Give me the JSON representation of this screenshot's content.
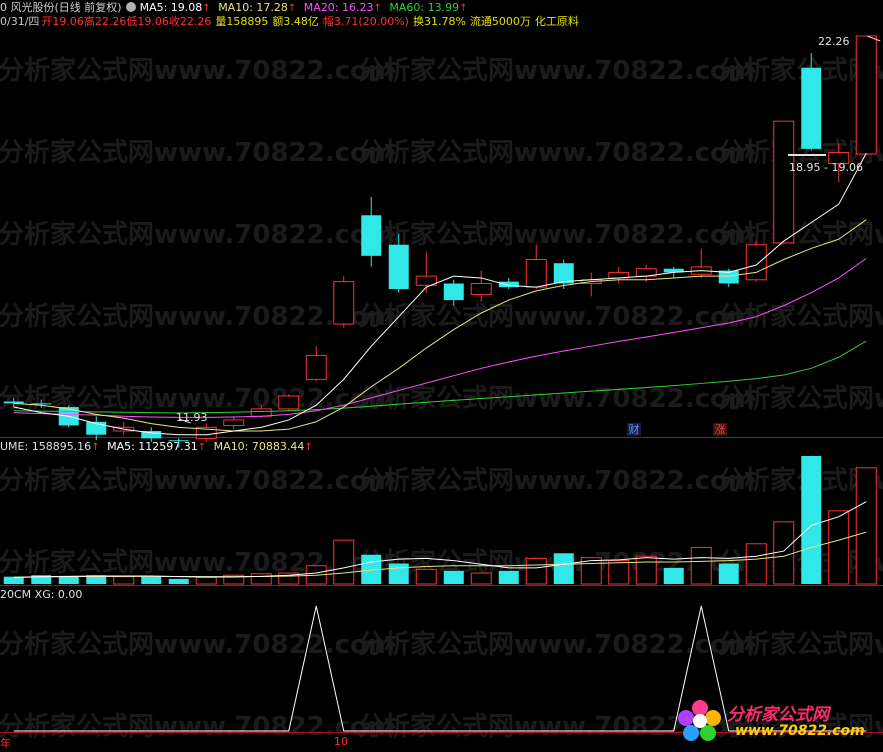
{
  "header": {
    "stock_name": "0 风光股份(日线 前复权)",
    "ma5": "MA5: 19.08",
    "ma10": "MA10: 17.28",
    "ma20": "MA20: 16.23",
    "ma60": "MA60: 13.99",
    "ma_colors": {
      "ma5": "#ffffff",
      "ma10": "#e6e680",
      "ma20": "#ff50ff",
      "ma60": "#30d030"
    }
  },
  "quote": {
    "date": "0/31/四",
    "open_label": "开",
    "open": "19.06",
    "high_label": "高",
    "high": "22.26",
    "low_label": "低",
    "low": "19.06",
    "close_label": "收",
    "close": "22.26",
    "volume_label": "量",
    "volume": "158895",
    "amount_label": "额",
    "amount": "3.48亿",
    "change_label": "幅",
    "change": "3.71(20.00%)",
    "turnover_label": "换",
    "turnover": "31.78%",
    "float_label": "流通",
    "float": "5000万",
    "sector": "化工原料"
  },
  "price_panel": {
    "high_marker": "22.26",
    "low_marker": "11.93",
    "range_marker": "18.95 - 19.06",
    "tags": [
      {
        "text": "财",
        "color": "#4aa0ff"
      },
      {
        "text": "涨",
        "color": "#ff4040"
      }
    ]
  },
  "volume_panel": {
    "volume": "UME: 158895.16",
    "ma5": "MA5: 112597.31",
    "ma10": "MA10: 70883.44"
  },
  "indicator_panel": {
    "label": "20CM XG: 0.00"
  },
  "x_axis": {
    "left_label": "年",
    "mid_label": "10"
  },
  "watermark": "分析家公式网www.70822.com",
  "logo": {
    "title": "分析家公式网",
    "url": "www.70822.com"
  },
  "colors": {
    "up": "#ff3030",
    "down": "#30e8e8",
    "panel_border": "#b01010"
  },
  "chart_data": {
    "type": "candlestick",
    "candles": [
      {
        "o": 12.35,
        "c": 12.3,
        "h": 12.45,
        "l": 12.2
      },
      {
        "o": 12.3,
        "c": 12.28,
        "h": 12.4,
        "l": 12.18
      },
      {
        "o": 12.2,
        "c": 11.7,
        "h": 12.25,
        "l": 11.65
      },
      {
        "o": 11.8,
        "c": 11.45,
        "h": 11.95,
        "l": 11.3
      },
      {
        "o": 11.55,
        "c": 11.65,
        "h": 11.8,
        "l": 11.45
      },
      {
        "o": 11.55,
        "c": 11.35,
        "h": 11.65,
        "l": 11.25
      },
      {
        "o": 11.3,
        "c": 11.28,
        "h": 11.35,
        "l": 11.1
      },
      {
        "o": 11.35,
        "c": 11.65,
        "h": 11.75,
        "l": 11.25
      },
      {
        "o": 11.7,
        "c": 11.85,
        "h": 11.95,
        "l": 11.6
      },
      {
        "o": 11.95,
        "c": 12.15,
        "h": 12.25,
        "l": 11.9
      },
      {
        "o": 12.15,
        "c": 12.5,
        "h": 12.55,
        "l": 12.1
      },
      {
        "o": 12.95,
        "c": 13.6,
        "h": 13.85,
        "l": 12.9
      },
      {
        "o": 14.45,
        "c": 15.6,
        "h": 15.75,
        "l": 14.35
      },
      {
        "o": 17.4,
        "c": 16.3,
        "h": 17.9,
        "l": 16.0
      },
      {
        "o": 16.6,
        "c": 15.4,
        "h": 16.9,
        "l": 15.3
      },
      {
        "o": 15.5,
        "c": 15.75,
        "h": 16.4,
        "l": 15.3
      },
      {
        "o": 15.55,
        "c": 15.1,
        "h": 15.65,
        "l": 14.95
      },
      {
        "o": 15.25,
        "c": 15.55,
        "h": 15.9,
        "l": 15.05
      },
      {
        "o": 15.6,
        "c": 15.45,
        "h": 15.7,
        "l": 15.4
      },
      {
        "o": 15.45,
        "c": 16.2,
        "h": 16.6,
        "l": 15.4
      },
      {
        "o": 16.1,
        "c": 15.55,
        "h": 16.2,
        "l": 15.4
      },
      {
        "o": 15.55,
        "c": 15.65,
        "h": 15.85,
        "l": 15.2
      },
      {
        "o": 15.7,
        "c": 15.85,
        "h": 16.0,
        "l": 15.55
      },
      {
        "o": 15.75,
        "c": 15.95,
        "h": 16.05,
        "l": 15.6
      },
      {
        "o": 15.95,
        "c": 15.85,
        "h": 16.0,
        "l": 15.7
      },
      {
        "o": 15.8,
        "c": 16.0,
        "h": 16.5,
        "l": 15.7
      },
      {
        "o": 15.9,
        "c": 15.55,
        "h": 15.95,
        "l": 15.45
      },
      {
        "o": 15.65,
        "c": 16.6,
        "h": 16.7,
        "l": 15.6
      },
      {
        "o": 16.65,
        "c": 19.95,
        "h": 19.95,
        "l": 16.65
      },
      {
        "o": 21.4,
        "c": 19.2,
        "h": 21.8,
        "l": 19.15
      },
      {
        "o": 18.8,
        "c": 19.1,
        "h": 19.35,
        "l": 18.3
      },
      {
        "o": 19.06,
        "c": 22.26,
        "h": 22.26,
        "l": 19.06
      }
    ],
    "ma5": [
      12.2,
      12.05,
      11.95,
      11.75,
      11.6,
      11.5,
      11.45,
      11.45,
      11.55,
      11.65,
      11.85,
      12.25,
      12.95,
      13.85,
      14.65,
      15.45,
      15.75,
      15.7,
      15.5,
      15.45,
      15.6,
      15.65,
      15.7,
      15.75,
      15.85,
      15.9,
      15.85,
      16.05,
      16.7,
      17.2,
      17.7,
      19.08
    ],
    "ma10": [
      12.3,
      12.25,
      12.15,
      12.0,
      11.9,
      11.75,
      11.65,
      11.6,
      11.55,
      11.55,
      11.6,
      11.8,
      12.2,
      12.75,
      13.25,
      13.8,
      14.3,
      14.75,
      15.1,
      15.35,
      15.5,
      15.6,
      15.65,
      15.65,
      15.7,
      15.75,
      15.75,
      15.85,
      16.2,
      16.5,
      16.75,
      17.28
    ],
    "ma20": [
      12.05,
      12.02,
      12.0,
      11.98,
      11.95,
      11.93,
      11.92,
      11.92,
      11.93,
      11.95,
      12.0,
      12.1,
      12.25,
      12.45,
      12.65,
      12.85,
      13.05,
      13.25,
      13.42,
      13.58,
      13.72,
      13.85,
      13.98,
      14.1,
      14.22,
      14.35,
      14.48,
      14.65,
      14.95,
      15.3,
      15.7,
      16.23
    ],
    "ma60": [
      12.1,
      12.09,
      12.08,
      12.07,
      12.06,
      12.05,
      12.04,
      12.05,
      12.06,
      12.08,
      12.1,
      12.13,
      12.17,
      12.22,
      12.28,
      12.33,
      12.38,
      12.43,
      12.48,
      12.53,
      12.58,
      12.63,
      12.68,
      12.73,
      12.78,
      12.84,
      12.9,
      12.97,
      13.07,
      13.25,
      13.55,
      13.99
    ],
    "price_range": [
      11.0,
      23.0
    ],
    "volume": [
      10000,
      12000,
      11000,
      12000,
      10000,
      10000,
      7000,
      9000,
      12000,
      14000,
      15000,
      25000,
      60000,
      40000,
      28000,
      20000,
      18000,
      15000,
      18000,
      35000,
      42000,
      36000,
      32000,
      38000,
      22000,
      50000,
      28000,
      55000,
      85000,
      175000,
      100000,
      158895
    ],
    "vol_ma5": [
      9000,
      10000,
      10500,
      11000,
      11000,
      11000,
      10000,
      9500,
      9500,
      10500,
      12000,
      15000,
      22000,
      30000,
      34000,
      35000,
      32000,
      27000,
      22000,
      22000,
      27000,
      32000,
      33000,
      36000,
      34000,
      36000,
      35000,
      38000,
      45000,
      80000,
      92000,
      112597
    ],
    "vol_ma10": [
      9000,
      9500,
      10000,
      10300,
      10500,
      10500,
      10300,
      10100,
      10100,
      10300,
      10800,
      12000,
      15000,
      19000,
      22000,
      24000,
      25000,
      25000,
      25000,
      26000,
      27000,
      28000,
      29000,
      30000,
      30000,
      31000,
      32000,
      34000,
      38000,
      50000,
      60000,
      70883
    ],
    "volume_range": [
      0,
      175000
    ],
    "xg_signal": [
      0,
      0,
      0,
      0,
      0,
      0,
      0,
      0,
      0,
      0,
      0,
      1,
      0,
      0,
      0,
      0,
      0,
      0,
      0,
      0,
      0,
      0,
      0,
      0,
      0,
      1,
      0,
      0,
      0,
      0,
      0,
      0
    ],
    "xg_at_index": {
      "first_peak": 11,
      "second_peak": 26
    }
  }
}
